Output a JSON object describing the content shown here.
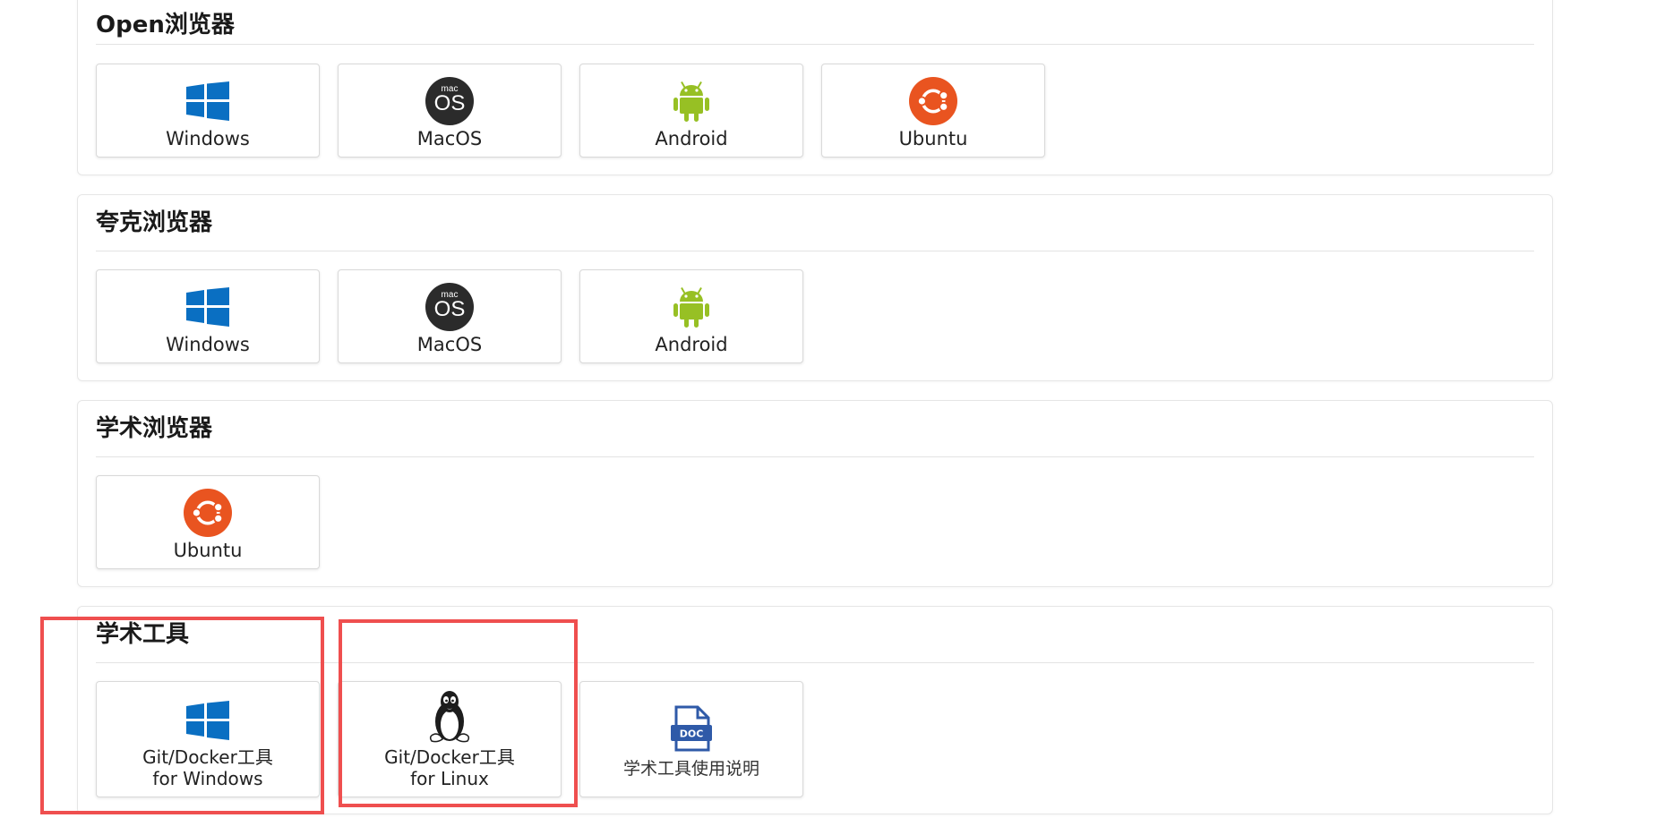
{
  "sections": [
    {
      "title": "Open浏览器",
      "tiles": [
        {
          "icon": "windows-icon",
          "label": "Windows"
        },
        {
          "icon": "macos-icon",
          "label": "MacOS",
          "icon_text_small": "mac",
          "icon_text_large": "OS"
        },
        {
          "icon": "android-icon",
          "label": "Android"
        },
        {
          "icon": "ubuntu-icon",
          "label": "Ubuntu"
        }
      ]
    },
    {
      "title": "夸克浏览器",
      "tiles": [
        {
          "icon": "windows-icon",
          "label": "Windows"
        },
        {
          "icon": "macos-icon",
          "label": "MacOS",
          "icon_text_small": "mac",
          "icon_text_large": "OS"
        },
        {
          "icon": "android-icon",
          "label": "Android"
        }
      ]
    },
    {
      "title": "学术浏览器",
      "tiles": [
        {
          "icon": "ubuntu-icon",
          "label": "Ubuntu"
        }
      ]
    },
    {
      "title": "学术工具",
      "tiles": [
        {
          "icon": "windows-icon",
          "label_line1": "Git/Docker工具",
          "label_line2": "for Windows"
        },
        {
          "icon": "linux-tux-icon",
          "label_line1": "Git/Docker工具",
          "label_line2": "for Linux"
        },
        {
          "icon": "doc-file-icon",
          "icon_text": "DOC",
          "label": "学术工具使用说明"
        }
      ]
    }
  ],
  "colors": {
    "windows": "#0a6fc2",
    "android": "#97c024",
    "ubuntu": "#e95420",
    "macos": "#2b2b2b",
    "doc": "#2f5aa8",
    "highlight": "#ef4f4f"
  }
}
